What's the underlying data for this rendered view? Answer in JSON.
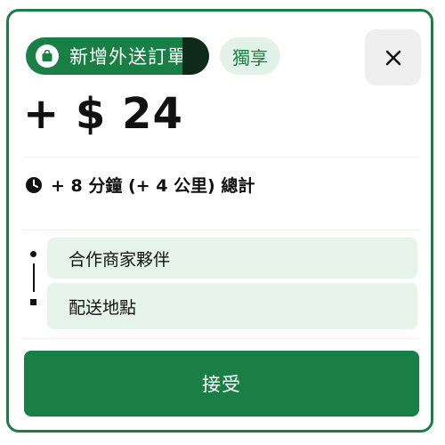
{
  "colors": {
    "brand_green": "#1a7f45",
    "light_green": "#e3f2e8",
    "text": "#111111"
  },
  "header": {
    "new_order_label": "新增外送訂單",
    "new_order_icon": "shopping-bag-icon",
    "exclusive_label": "獨享",
    "close_icon": "close-icon"
  },
  "order": {
    "price": "+ $ 24",
    "time_icon": "clock-icon",
    "time_summary": "+ 8 分鐘 (+ 4 公里) 總計"
  },
  "route": {
    "pickup_label": "合作商家夥伴",
    "dropoff_label": "配送地點"
  },
  "actions": {
    "accept_label": "接受"
  }
}
